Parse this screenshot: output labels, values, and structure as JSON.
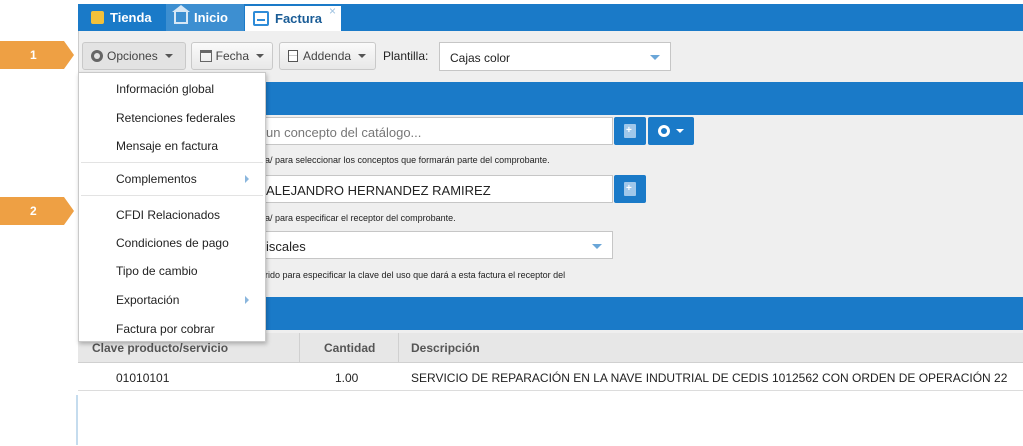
{
  "tabs": [
    {
      "label": "Tienda",
      "icon": "store-icon"
    },
    {
      "label": "Inicio",
      "icon": "home-icon"
    },
    {
      "label": "Factura",
      "icon": "document-icon",
      "close": "×"
    }
  ],
  "markers": [
    "1",
    "2"
  ],
  "toolbar": {
    "opciones_label": "Opciones",
    "fecha_label": "Fecha",
    "addenda_label": "Addenda",
    "plantilla_label": "Plantilla:",
    "plantilla_value": "Cajas color"
  },
  "menu": {
    "items": [
      "Información global",
      "Retenciones federales",
      "Mensaje en factura",
      "Complementos",
      "CFDI Relacionados",
      "Condiciones de pago",
      "Tipo de cambio",
      "Exportación",
      "Factura por cobrar"
    ]
  },
  "form": {
    "concepto_placeholder": "un concepto del catálogo...",
    "concepto_hint": "a/ para seleccionar los conceptos que formarán parte del comprobante.",
    "receptor_value": "ALEJANDRO HERNANDEZ RAMIREZ",
    "receptor_hint": "a/ para especificar el receptor del comprobante.",
    "uso_value": "iscales",
    "uso_hint": "rido para especificar la clave del uso que dará a esta factura el receptor del"
  },
  "table": {
    "headers": [
      "Clave producto/servicio",
      "Cantidad",
      "Descripción"
    ],
    "rows": [
      {
        "clave": "01010101",
        "cantidad": "1.00",
        "descripcion": "SERVICIO DE REPARACIÓN EN LA NAVE INDUTRIAL DE CEDIS 1012562 CON ORDEN DE OPERACIÓN 22"
      }
    ]
  },
  "colors": {
    "primary": "#1a7ac8",
    "marker": "#eea044",
    "background": "#efefef"
  }
}
